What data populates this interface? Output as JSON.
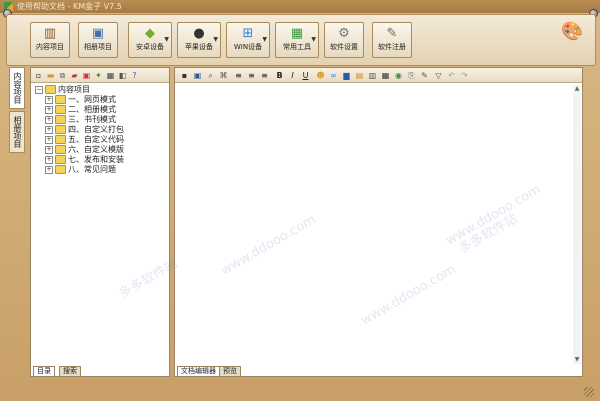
{
  "window": {
    "title": "使用帮助文档 - KM盒子 V7.5"
  },
  "ribbon": {
    "buttons": [
      {
        "label": "内容项目",
        "icon": "book-icon"
      },
      {
        "label": "相册项目",
        "icon": "photo-album-icon"
      },
      {
        "label": "安卓设备",
        "icon": "android-icon",
        "dropdown": true
      },
      {
        "label": "苹果设备",
        "icon": "apple-icon",
        "dropdown": true
      },
      {
        "label": "WIN设备",
        "icon": "windows-icon",
        "dropdown": true
      },
      {
        "label": "常用工具",
        "icon": "tools-icon",
        "dropdown": true
      },
      {
        "label": "软件设置",
        "icon": "gear-icon"
      },
      {
        "label": "软件注册",
        "icon": "register-icon"
      }
    ],
    "skin_icon": "palette-icon"
  },
  "side_tabs": {
    "content": "内容项目",
    "album": "相册项目"
  },
  "tree": {
    "root": "内容项目",
    "items": [
      "一、网页模式",
      "二、相册模式",
      "三、书刊模式",
      "四、自定义打包",
      "五、自定义代码",
      "六、自定义模版",
      "七、发布和安装",
      "八、常见问题"
    ]
  },
  "left_panel": {
    "tabs": [
      "目录",
      "搜索"
    ]
  },
  "editor": {
    "tabs": [
      "文档编辑器",
      "预览"
    ]
  },
  "watermarks": [
    "多多软件站",
    "www.ddooo.com"
  ],
  "colors": {
    "frame": "#c9a46c",
    "ribbon": "#f3ead8",
    "folder": "#f3d35a"
  }
}
